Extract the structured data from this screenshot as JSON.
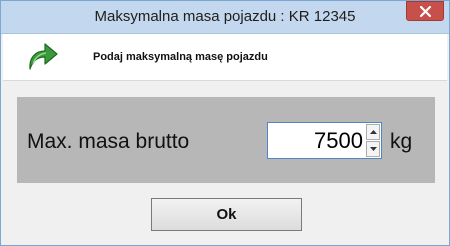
{
  "window": {
    "title": "Maksymalna masa pojazdu : KR 12345"
  },
  "header": {
    "icon": "redo-arrow-icon",
    "prompt": "Podaj maksymalną masę pojazdu"
  },
  "form": {
    "label": "Max. masa brutto",
    "value": "7500",
    "unit": "kg"
  },
  "buttons": {
    "ok": "Ok"
  },
  "colors": {
    "titlebar": "#c3d8ee",
    "close_button": "#c7504a",
    "panel": "#b7b7b7",
    "arrow": "#2f8a2f"
  }
}
